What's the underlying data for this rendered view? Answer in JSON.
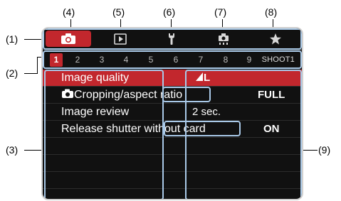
{
  "callouts": {
    "c1": "(1)",
    "c2": "(2)",
    "c3": "(3)",
    "c4": "(4)",
    "c5": "(5)",
    "c6": "(6)",
    "c7": "(7)",
    "c8": "(8)",
    "c9": "(9)"
  },
  "tabs": [
    {
      "icon": "camera-icon",
      "active": true
    },
    {
      "icon": "playback-icon",
      "active": false
    },
    {
      "icon": "wrench-icon",
      "active": false
    },
    {
      "icon": "custom-function-icon",
      "active": false
    },
    {
      "icon": "star-icon",
      "active": false
    }
  ],
  "subtabs": {
    "items": [
      "1",
      "2",
      "3",
      "4",
      "5",
      "6",
      "7",
      "8",
      "9"
    ],
    "active_index": 0,
    "page_label": "SHOOT1"
  },
  "menu": {
    "items": [
      {
        "label": "Image quality",
        "value": "L",
        "selected": true
      },
      {
        "label": "Cropping/aspect ratio",
        "value": "FULL",
        "selected": false
      },
      {
        "label": "Image review",
        "value": "2 sec.",
        "selected": false
      },
      {
        "label": "Release shutter without card",
        "value": "ON",
        "selected": false
      },
      {
        "label": "",
        "value": "",
        "selected": false
      },
      {
        "label": "",
        "value": "",
        "selected": false
      },
      {
        "label": "",
        "value": "",
        "selected": false
      }
    ]
  },
  "colors": {
    "accent": "#c2272d",
    "screen_bg": "#111111",
    "callout_frame": "#a9c9e8"
  }
}
